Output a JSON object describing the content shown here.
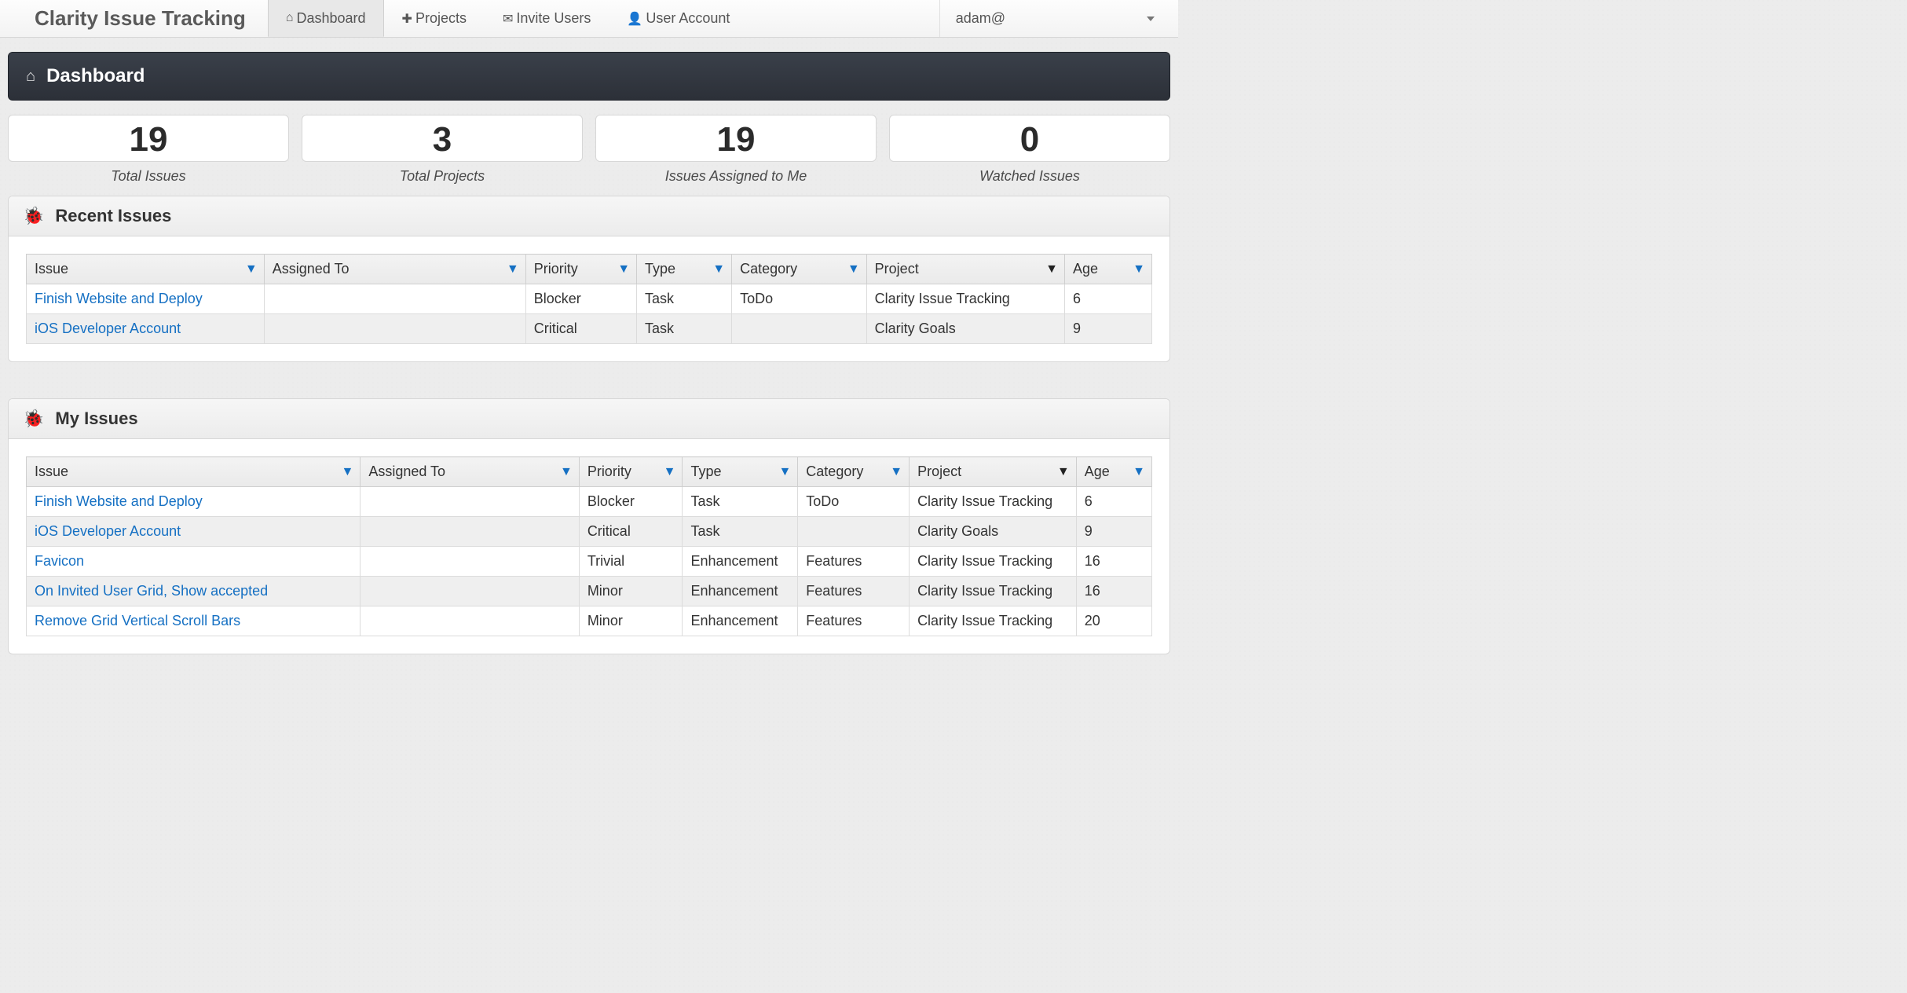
{
  "brand": "Clarity Issue Tracking",
  "nav": {
    "dashboard": "Dashboard",
    "projects": "Projects",
    "invite": "Invite Users",
    "account": "User Account"
  },
  "user": {
    "name": "adam@"
  },
  "page_title": "Dashboard",
  "stats": [
    {
      "value": "19",
      "label": "Total Issues"
    },
    {
      "value": "3",
      "label": "Total Projects"
    },
    {
      "value": "19",
      "label": "Issues Assigned to Me"
    },
    {
      "value": "0",
      "label": "Watched Issues"
    }
  ],
  "columns": {
    "issue": "Issue",
    "assigned": "Assigned To",
    "priority": "Priority",
    "type": "Type",
    "category": "Category",
    "project": "Project",
    "age": "Age"
  },
  "panels": {
    "recent": "Recent Issues",
    "mine": "My Issues"
  },
  "recent_issues": [
    {
      "issue": "Finish Website and Deploy",
      "assigned": "",
      "priority": "Blocker",
      "type": "Task",
      "category": "ToDo",
      "project": "Clarity Issue Tracking",
      "age": "6"
    },
    {
      "issue": "iOS Developer Account",
      "assigned": "",
      "priority": "Critical",
      "type": "Task",
      "category": "",
      "project": "Clarity Goals",
      "age": "9"
    }
  ],
  "my_issues": [
    {
      "issue": "Finish Website and Deploy",
      "assigned": "",
      "priority": "Blocker",
      "type": "Task",
      "category": "ToDo",
      "project": "Clarity Issue Tracking",
      "age": "6"
    },
    {
      "issue": "iOS Developer Account",
      "assigned": "",
      "priority": "Critical",
      "type": "Task",
      "category": "",
      "project": "Clarity Goals",
      "age": "9"
    },
    {
      "issue": "Favicon",
      "assigned": "",
      "priority": "Trivial",
      "type": "Enhancement",
      "category": "Features",
      "project": "Clarity Issue Tracking",
      "age": "16"
    },
    {
      "issue": "On Invited User Grid, Show accepted",
      "assigned": "",
      "priority": "Minor",
      "type": "Enhancement",
      "category": "Features",
      "project": "Clarity Issue Tracking",
      "age": "16"
    },
    {
      "issue": "Remove Grid Vertical Scroll Bars",
      "assigned": "",
      "priority": "Minor",
      "type": "Enhancement",
      "category": "Features",
      "project": "Clarity Issue Tracking",
      "age": "20"
    }
  ]
}
